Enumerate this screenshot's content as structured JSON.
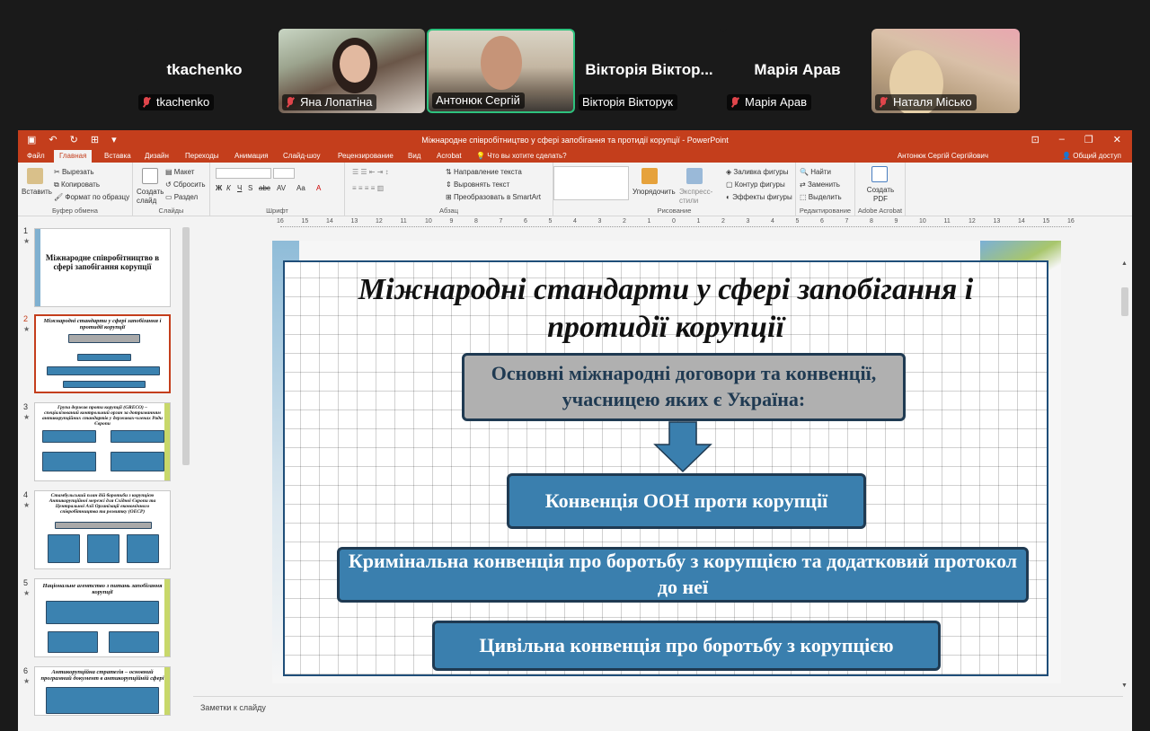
{
  "participants": [
    {
      "display_name": "tkachenko",
      "caption": "tkachenko",
      "muted": true,
      "video": false
    },
    {
      "display_name": "",
      "caption": "Яна Лопатіна",
      "muted": true,
      "video": true
    },
    {
      "display_name": "",
      "caption": "Антонюк Сергій",
      "muted": false,
      "video": true,
      "active_speaker": true
    },
    {
      "display_name": "Вікторія Віктор...",
      "caption": "Вікторія Вікторук",
      "muted": false,
      "video": false
    },
    {
      "display_name": "Марія Арав",
      "caption": "Марія Арав",
      "muted": true,
      "video": false
    },
    {
      "display_name": "",
      "caption": "Наталя Місько",
      "muted": true,
      "video": true
    }
  ],
  "ppt": {
    "window_title": "Міжнародне співробітництво у сфері запобігання та протидії корупції - PowerPoint",
    "tabs": [
      "Файл",
      "Главная",
      "Вставка",
      "Дизайн",
      "Переходы",
      "Анимация",
      "Слайд-шоу",
      "Рецензирование",
      "Вид",
      "Acrobat"
    ],
    "active_tab": "Главная",
    "tell_me": "Что вы хотите сделать?",
    "user_name": "Антонюк Сергій Сергійович",
    "share_label": "Общий доступ",
    "ribbon": {
      "clipboard": {
        "paste": "Вставить",
        "cut": "Вырезать",
        "copy": "Копировать",
        "format_painter": "Формат по образцу",
        "label": "Буфер обмена"
      },
      "slides": {
        "new_slide": "Создать слайд",
        "layout": "Макет",
        "reset": "Сбросить",
        "section": "Раздел",
        "label": "Слайды"
      },
      "font": {
        "label": "Шрифт",
        "bold": "Ж",
        "italic": "К",
        "underline": "Ч",
        "strike": "S",
        "abc": "abc",
        "spacing": "AV",
        "case": "Aa",
        "color": "A"
      },
      "paragraph": {
        "text_direction": "Направление текста",
        "align_text": "Выровнять текст",
        "smartart": "Преобразовать в SmartArt",
        "label": "Абзац"
      },
      "drawing": {
        "arrange": "Упорядочить",
        "quick_styles": "Экспресс-стили",
        "fill": "Заливка фигуры",
        "outline": "Контур фигуры",
        "effects": "Эффекты фигуры",
        "label": "Рисование"
      },
      "editing": {
        "find": "Найти",
        "replace": "Заменить",
        "select": "Выделить",
        "label": "Редактирование"
      },
      "acrobat": {
        "create_pdf": "Создать PDF",
        "label": "Adobe Acrobat"
      }
    },
    "ruler_ticks": [
      "16",
      "15",
      "14",
      "13",
      "12",
      "11",
      "10",
      "9",
      "8",
      "7",
      "6",
      "5",
      "4",
      "3",
      "2",
      "1",
      "0",
      "1",
      "2",
      "3",
      "4",
      "5",
      "6",
      "7",
      "8",
      "9",
      "10",
      "11",
      "12",
      "13",
      "14",
      "15",
      "16"
    ],
    "thumbnails": [
      {
        "number": "1",
        "title": "Міжнародне співробітництво в сфері запобігання корупції"
      },
      {
        "number": "2",
        "title": "Міжнародні стандарти у сфері запобігання і протидії корупції"
      },
      {
        "number": "3",
        "title": "Група держав проти корупції (GRECO) – спеціалізований контрольний орган за дотриманням антикорупційних стандартів у державах-членах Ради Європи"
      },
      {
        "number": "4",
        "title": "Стамбульський план дій боротьби з корупцією Антикорупційної мережі для Східної Європи та Центральної Азії Організації економічного співробітництва та розвитку (ОЕСР)"
      },
      {
        "number": "5",
        "title": "Національне агентство з питань запобігання корупції"
      },
      {
        "number": "6",
        "title": "Антикорупційна стратегія – основний програмний документ в антикорупційній сфері"
      }
    ],
    "slide": {
      "title": "Міжнародні стандарти у сфері запобігання і протидії корупції",
      "box_header": "Основні міжнародні договори та конвенції, учасницею яких є Україна:",
      "box_1": "Конвенція ООН проти корупції",
      "box_2": "Кримінальна конвенція про боротьбу з корупцією та додатковий протокол до неї",
      "box_3": "Цивільна конвенція про боротьбу з корупцією"
    },
    "notes_placeholder": "Заметки к слайду",
    "colors": {
      "accent": "#c43e1c",
      "box_blue": "#3a7fae",
      "box_border": "#1f3a52",
      "box_grey": "#b0b0b0"
    }
  }
}
